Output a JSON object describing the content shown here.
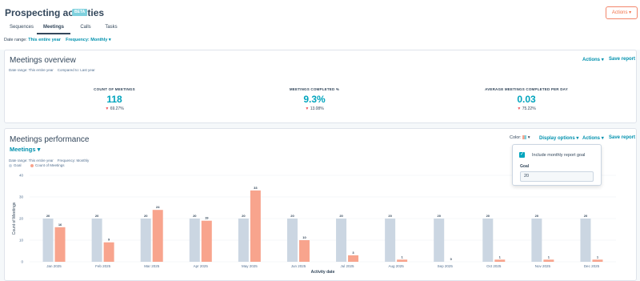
{
  "header": {
    "title": "Prospecting activities",
    "badge": "BETA",
    "actions_label": "Actions",
    "tabs": [
      "Sequences",
      "Meetings",
      "Calls",
      "Tasks"
    ],
    "active_tab": "Meetings"
  },
  "filters": {
    "date_range_label": "Date range:",
    "date_range_value": "This entire year",
    "frequency_label": "Frequency:",
    "frequency_value": "Monthly"
  },
  "overview": {
    "title": "Meetings overview",
    "actions_label": "Actions",
    "save_label": "Save report",
    "meta_date": "Date range: This entire year",
    "meta_compare": "Compared to: Last year",
    "kpis": [
      {
        "label": "COUNT OF MEETINGS",
        "value": "118",
        "change": "69.27%"
      },
      {
        "label": "MEETINGS COMPLETED %",
        "value": "9.3%",
        "change": "13.08%"
      },
      {
        "label": "AVERAGE MEETINGS COMPLETED PER DAY",
        "value": "0.03",
        "change": "75.22%"
      }
    ]
  },
  "performance": {
    "title": "Meetings performance",
    "metric_select": "Meetings",
    "color_label": "Color:",
    "display_options_label": "Display options",
    "actions_label": "Actions",
    "save_label": "Save report",
    "meta_date": "Date range: This entire year",
    "meta_frequency": "Frequency: Monthly",
    "popover": {
      "checkbox_label": "Include monthly report goal",
      "goal_label": "Goal",
      "goal_value": "20"
    }
  },
  "colors": {
    "accent": "#00a4bd",
    "goal_bar": "#cbd6e2",
    "meetings_bar": "#f8a48d",
    "link": "#0091ae"
  },
  "chart_data": {
    "type": "bar",
    "categories": [
      "Jan 2025",
      "Feb 2025",
      "Mar 2025",
      "Apr 2025",
      "May 2025",
      "Jun 2025",
      "Jul 2025",
      "Aug 2025",
      "Sep 2025",
      "Oct 2025",
      "Nov 2025",
      "Dec 2025"
    ],
    "series": [
      {
        "name": "Goal",
        "values": [
          20,
          20,
          20,
          20,
          20,
          20,
          20,
          20,
          20,
          20,
          20,
          20
        ],
        "color": "#cbd6e2"
      },
      {
        "name": "Count of Meetings",
        "values": [
          16,
          9,
          24,
          19,
          33,
          10,
          3,
          1,
          0,
          1,
          1,
          1
        ],
        "color": "#f8a48d"
      }
    ],
    "xlabel": "Activity date",
    "ylabel": "Count of Meetings",
    "yticks": [
      0,
      10,
      20,
      30,
      40
    ],
    "ylim": [
      0,
      40
    ],
    "grid": true,
    "legend": "top-left"
  }
}
